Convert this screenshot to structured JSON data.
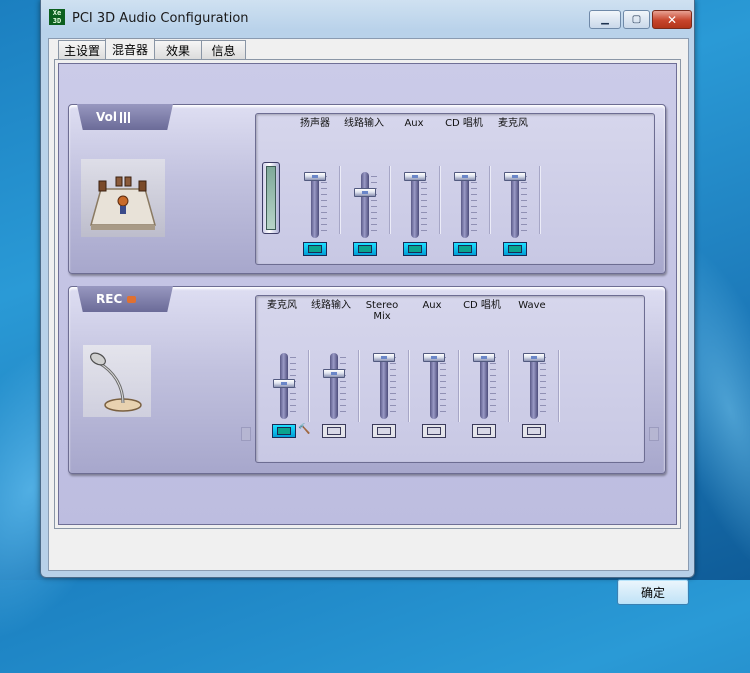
{
  "window": {
    "title": "PCI 3D Audio Configuration",
    "logo_text": "Xear 3D",
    "minimize_glyph": "▁",
    "maximize_glyph": "▢",
    "close_glyph": "✕"
  },
  "tabs": [
    {
      "label": "主设置",
      "active": false
    },
    {
      "label": "混音器",
      "active": true
    },
    {
      "label": "效果",
      "active": false
    },
    {
      "label": "信息",
      "active": false
    }
  ],
  "playback": {
    "panel_label": "Vol",
    "channels": [
      {
        "label": "扬声器",
        "level": 1.0,
        "selected": true
      },
      {
        "label": "线路输入",
        "level": 0.72,
        "selected": true
      },
      {
        "label": "Aux",
        "level": 1.0,
        "selected": true
      },
      {
        "label": "CD 唱机",
        "level": 1.0,
        "selected": true
      },
      {
        "label": "麦克风",
        "level": 1.0,
        "selected": true
      }
    ]
  },
  "record": {
    "panel_label": "REC",
    "channels": [
      {
        "label": "麦克风",
        "level": 0.55,
        "selected": true
      },
      {
        "label": "线路输入",
        "level": 0.72,
        "selected": false
      },
      {
        "label": "Stereo\nMix",
        "level": 1.0,
        "selected": false
      },
      {
        "label": "Aux",
        "level": 1.0,
        "selected": false
      },
      {
        "label": "CD 唱机",
        "level": 1.0,
        "selected": false
      },
      {
        "label": "Wave",
        "level": 1.0,
        "selected": false
      }
    ],
    "mic_settings_glyph": "🔨"
  },
  "footer": {
    "ok_label": "确定"
  },
  "colors": {
    "panel_bg": "#c5c5e2",
    "select_on": "#1fd0f6",
    "title_bar": "#c4d9ef"
  }
}
